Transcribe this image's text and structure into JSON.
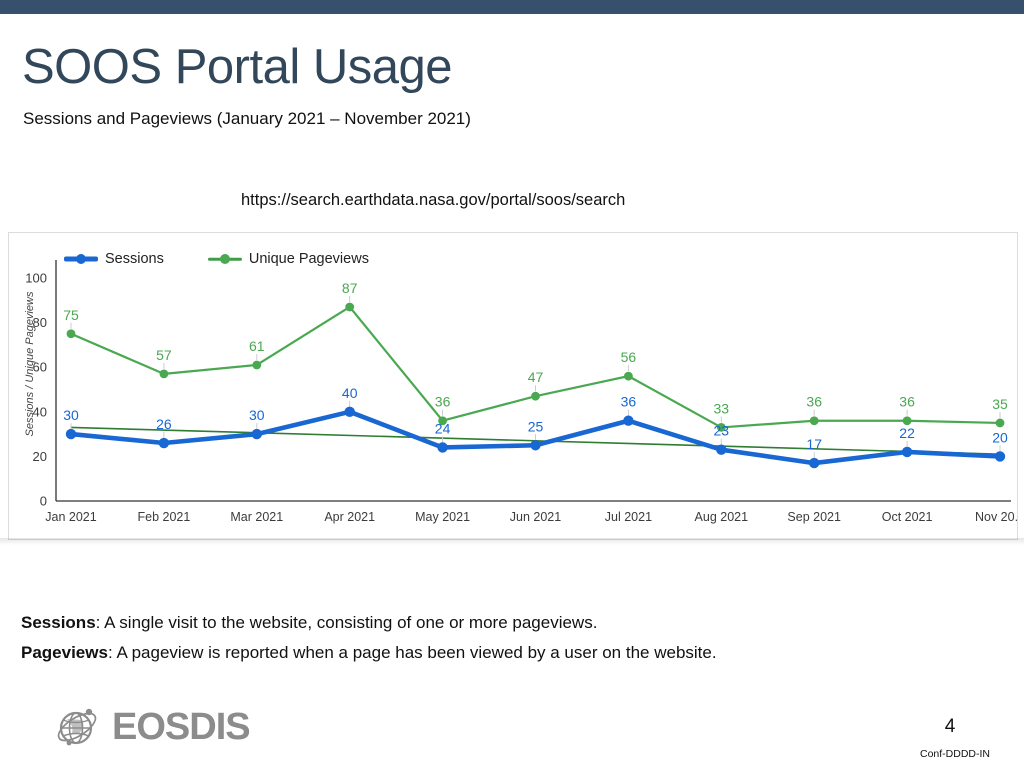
{
  "slide": {
    "title": "SOOS Portal Usage",
    "subtitle": "Sessions and Pageviews (January 2021 – November 2021)",
    "url": "https://search.earthdata.nasa.gov/portal/soos/search",
    "page_number": "4",
    "conf_code": "Conf-DDDD-IN",
    "accent_bar_color": "#36506e",
    "title_color": "#33475b"
  },
  "definitions": [
    {
      "term": "Sessions",
      "text": ": A single visit to the website, consisting of one or more pageviews."
    },
    {
      "term": "Pageviews",
      "text": ": A pageview is reported when a page has been viewed by a user on the website."
    }
  ],
  "footer": {
    "logo_text": "EOSDIS",
    "logo_icon": "globe-satellite-icon",
    "logo_color": "#8c8c8c"
  },
  "chart_data": {
    "type": "line",
    "title": "",
    "xlabel": "",
    "ylabel": "Sessions / Unique Pageviews",
    "ylim": [
      0,
      100
    ],
    "yticks": [
      0,
      20,
      40,
      60,
      80,
      100
    ],
    "ytick_labels": [
      "0",
      "20",
      "40",
      "60",
      "80",
      "100"
    ],
    "grid": false,
    "legend_position": "top-left",
    "categories": [
      "Jan 2021",
      "Feb 2021",
      "Mar 2021",
      "Apr 2021",
      "May 2021",
      "Jun 2021",
      "Jul 2021",
      "Aug 2021",
      "Sep 2021",
      "Oct 2021",
      "Nov 20..."
    ],
    "series": [
      {
        "name": "Sessions",
        "color": "#1967d2",
        "values": [
          30,
          26,
          30,
          40,
          24,
          25,
          36,
          23,
          17,
          22,
          20
        ],
        "labels": [
          "30",
          "26",
          "30",
          "40",
          "24",
          "25",
          "36",
          "23",
          "17",
          "22",
          "20"
        ]
      },
      {
        "name": "Unique Pageviews",
        "color": "#4aa851",
        "values": [
          75,
          57,
          61,
          87,
          36,
          47,
          56,
          33,
          36,
          36,
          35
        ],
        "labels": [
          "75",
          "57",
          "61",
          "87",
          "36",
          "47",
          "56",
          "33",
          "36",
          "36",
          "35"
        ]
      }
    ],
    "trendline": {
      "name": "trendline",
      "color": "#2e7d32",
      "start_value": 33,
      "end_value": 21
    }
  }
}
